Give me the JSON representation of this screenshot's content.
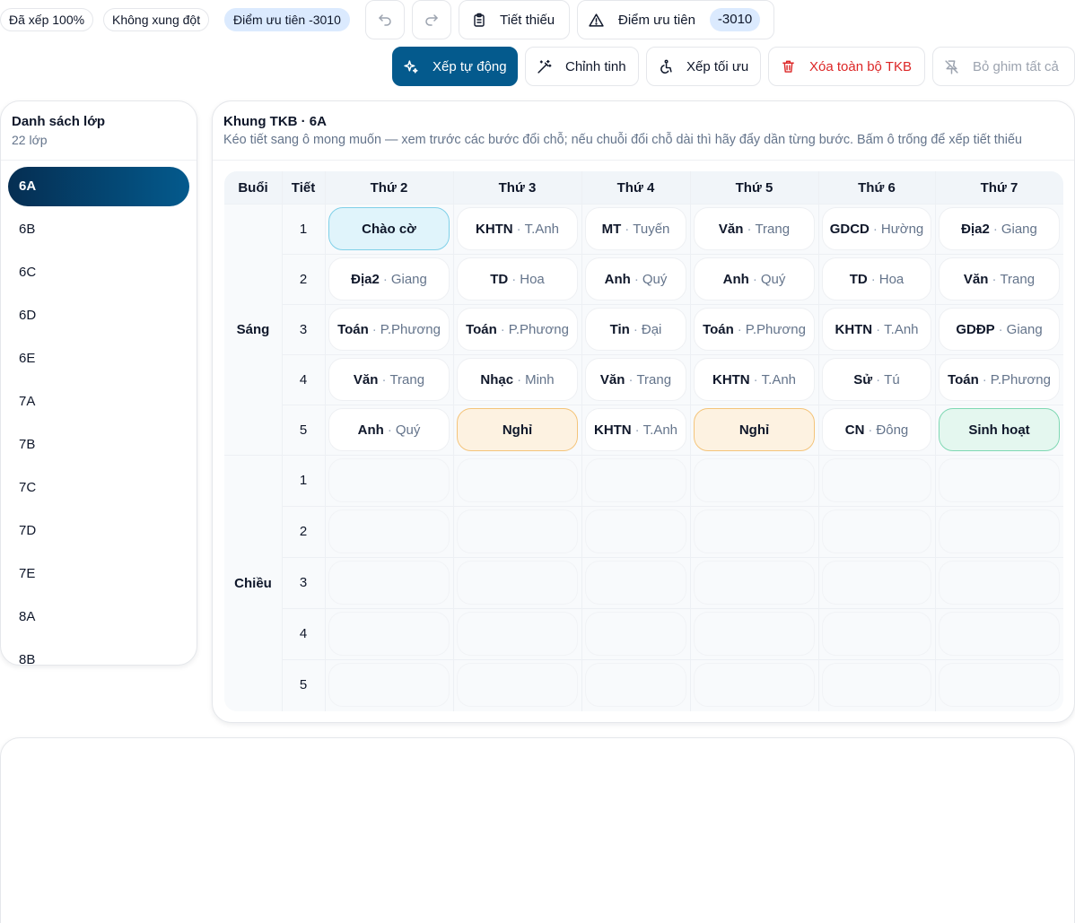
{
  "status": {
    "placed": "Đã xếp 100%",
    "conflicts": "Không xung đột",
    "priority_score": "Điểm ưu tiên -3010"
  },
  "toolbar": {
    "undo_icon": "undo-icon",
    "redo_icon": "redo-icon",
    "missing_label": "Tiết thiếu",
    "priority_label": "Điểm ưu tiên",
    "priority_value": "-3010",
    "auto_label": "Xếp tự động",
    "adjust_label": "Chỉnh tinh",
    "optimize_label": "Xếp tối ưu",
    "clear_label": "Xóa toàn bộ TKB",
    "unpin_label": "Bỏ ghim tất cả"
  },
  "class_panel": {
    "title": "Danh sách lớp",
    "count": "22 lớp",
    "items": [
      "6A",
      "6B",
      "6C",
      "6D",
      "6E",
      "7A",
      "7B",
      "7C",
      "7D",
      "7E",
      "8A",
      "8B"
    ],
    "active": "6A"
  },
  "timetable": {
    "title": "Khung TKB · 6A",
    "description": "Kéo tiết sang ô mong muốn — xem trước các bước đổi chỗ; nếu chuỗi đổi chỗ dài thì hãy đẩy dần từng bước. Bấm ô trống để xếp tiết thiếu",
    "headers": {
      "session": "Buổi",
      "period": "Tiết",
      "days": [
        "Thứ 2",
        "Thứ 3",
        "Thứ 4",
        "Thứ 5",
        "Thứ 6",
        "Thứ 7"
      ]
    },
    "sessions": [
      "Sáng",
      "Chiều"
    ],
    "periods": [
      "1",
      "2",
      "3",
      "4",
      "5"
    ],
    "morning": [
      [
        {
          "special": "Chào cờ",
          "kind": "chaoco"
        },
        {
          "subject": "KHTN",
          "teacher": "T.Anh"
        },
        {
          "subject": "MT",
          "teacher": "Tuyến"
        },
        {
          "subject": "Văn",
          "teacher": "Trang"
        },
        {
          "subject": "GDCD",
          "teacher": "Hường"
        },
        {
          "subject": "Địa2",
          "teacher": "Giang"
        }
      ],
      [
        {
          "subject": "Địa2",
          "teacher": "Giang"
        },
        {
          "subject": "TD",
          "teacher": "Hoa"
        },
        {
          "subject": "Anh",
          "teacher": "Quý"
        },
        {
          "subject": "Anh",
          "teacher": "Quý"
        },
        {
          "subject": "TD",
          "teacher": "Hoa"
        },
        {
          "subject": "Văn",
          "teacher": "Trang"
        }
      ],
      [
        {
          "subject": "Toán",
          "teacher": "P.Phương"
        },
        {
          "subject": "Toán",
          "teacher": "P.Phương"
        },
        {
          "subject": "Tin",
          "teacher": "Đại"
        },
        {
          "subject": "Toán",
          "teacher": "P.Phương"
        },
        {
          "subject": "KHTN",
          "teacher": "T.Anh"
        },
        {
          "subject": "GDĐP",
          "teacher": "Giang"
        }
      ],
      [
        {
          "subject": "Văn",
          "teacher": "Trang"
        },
        {
          "subject": "Nhạc",
          "teacher": "Minh"
        },
        {
          "subject": "Văn",
          "teacher": "Trang"
        },
        {
          "subject": "KHTN",
          "teacher": "T.Anh"
        },
        {
          "subject": "Sử",
          "teacher": "Tú"
        },
        {
          "subject": "Toán",
          "teacher": "P.Phương"
        }
      ],
      [
        {
          "subject": "Anh",
          "teacher": "Quý"
        },
        {
          "special": "Nghỉ",
          "kind": "nghi"
        },
        {
          "subject": "KHTN",
          "teacher": "T.Anh"
        },
        {
          "special": "Nghỉ",
          "kind": "nghi"
        },
        {
          "subject": "CN",
          "teacher": "Đông"
        },
        {
          "special": "Sinh hoạt",
          "kind": "sinhhoat"
        }
      ]
    ]
  },
  "colors": {
    "primary": "#045a8d",
    "danger": "#dc2626",
    "chaoco_bg": "#e0f4fb",
    "nghi_bg": "#fdf2e1",
    "sinhhoat_bg": "#e4f7ef"
  }
}
